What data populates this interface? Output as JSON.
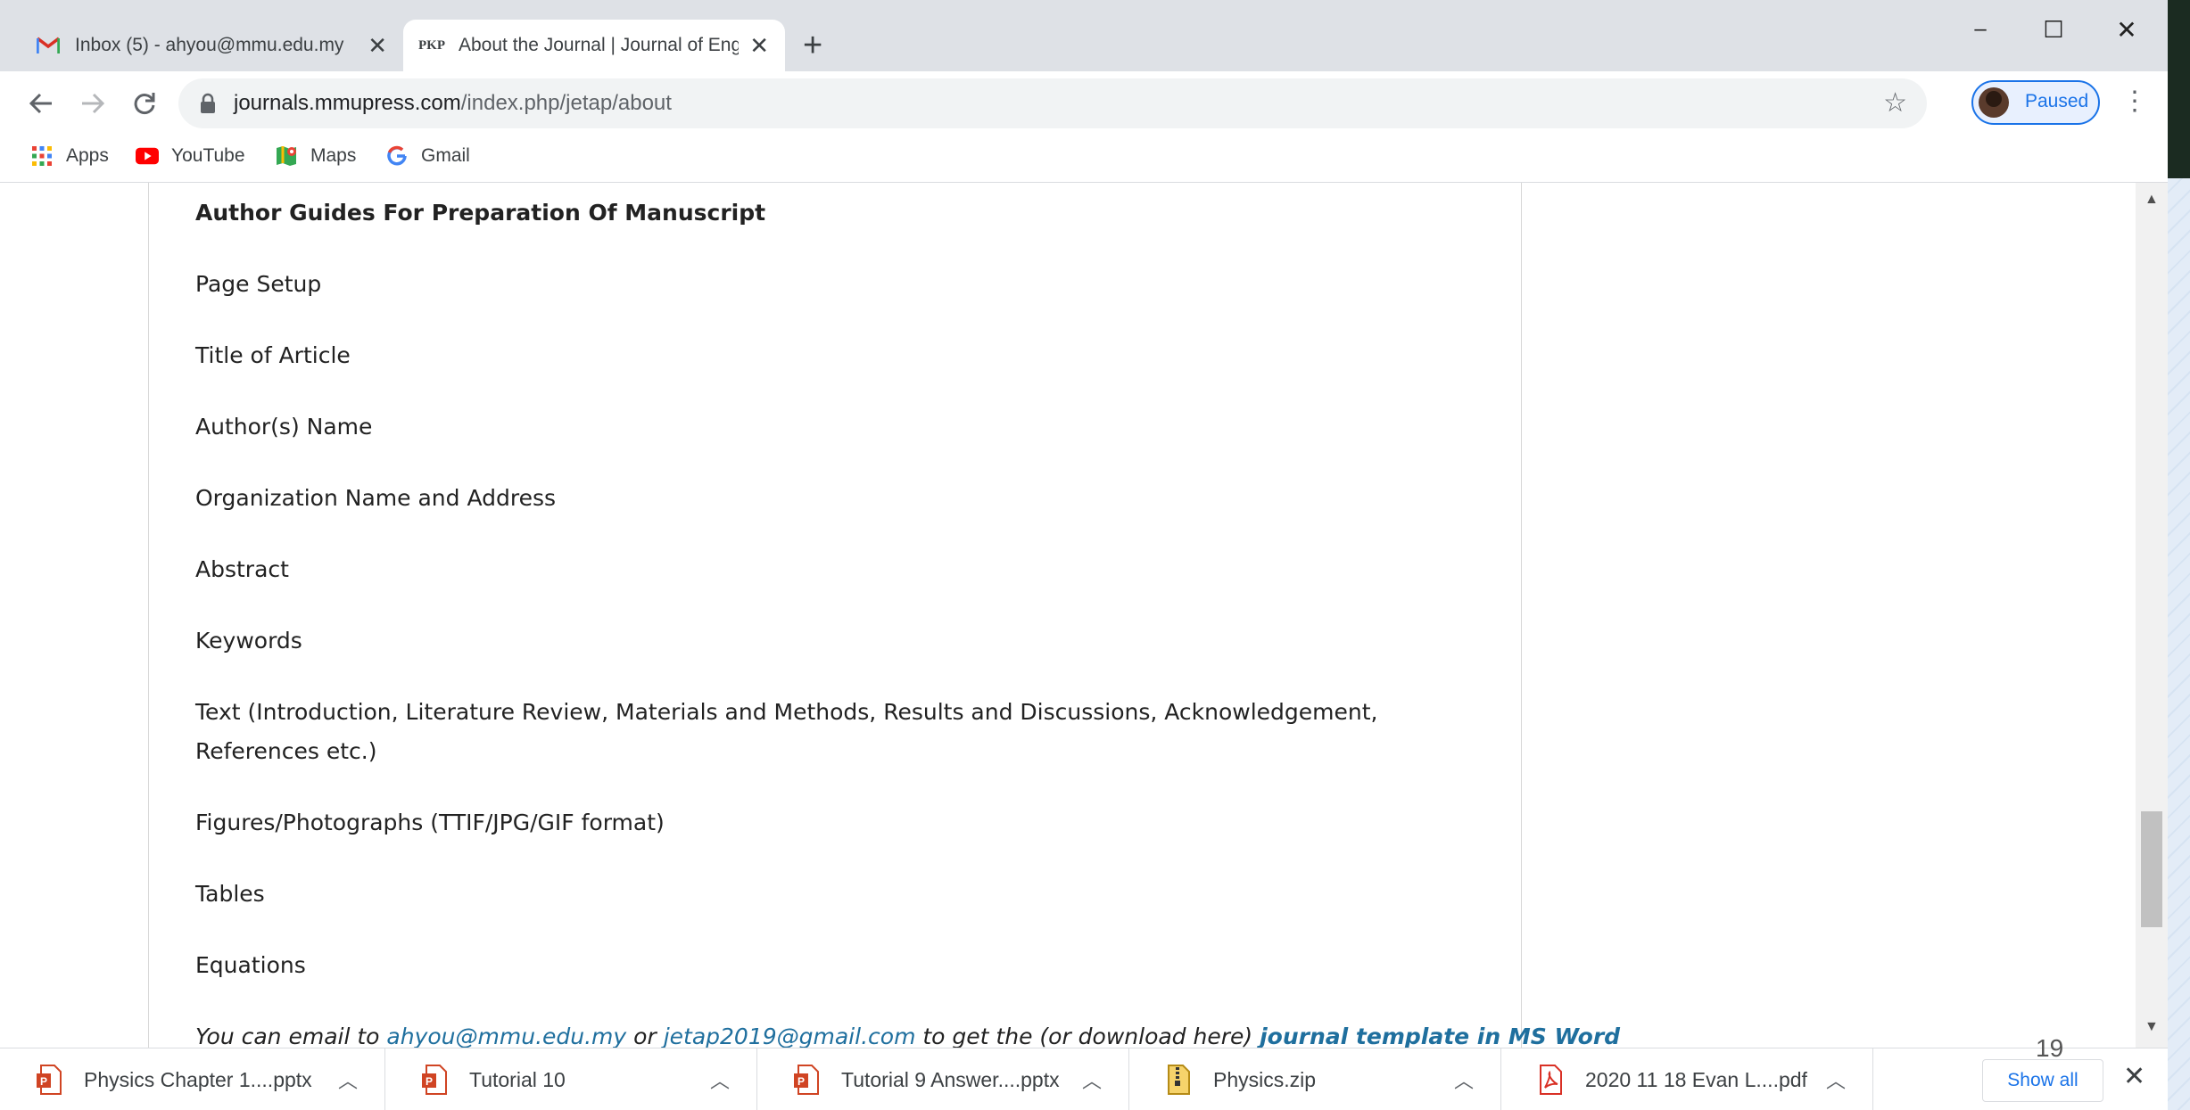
{
  "tabs": [
    {
      "title": "Inbox (5) - ahyou@mmu.edu.my",
      "favicon": "gmail-icon",
      "active": false
    },
    {
      "title": "About the Journal | Journal of Eng",
      "favicon": "PKP",
      "active": true
    }
  ],
  "window_controls": {
    "minimize": "–",
    "maximize": "☐",
    "close": "✕"
  },
  "address_bar": {
    "host": "journals.mmupress.com",
    "path": "/index.php/jetap/about"
  },
  "profile": {
    "label": "Paused"
  },
  "bookmarks": [
    {
      "label": "Apps",
      "icon": "apps-grid-icon"
    },
    {
      "label": "YouTube",
      "icon": "youtube-icon"
    },
    {
      "label": "Maps",
      "icon": "maps-icon"
    },
    {
      "label": "Gmail",
      "icon": "google-icon"
    }
  ],
  "page": {
    "heading": "Author Guides For Preparation Of Manuscript",
    "items": [
      "Page Setup",
      "Title of Article",
      "Author(s) Name",
      "Organization Name and Address",
      "Abstract",
      "Keywords",
      "Text (Introduction, Literature Review, Materials and Methods, Results and Discussions, Acknowledgement, References etc.)",
      "Figures/Photographs (TTIF/JPG/GIF format)",
      "Tables",
      "Equations"
    ],
    "note": {
      "prefix": "You can email to",
      "email1": "ahyou@mmu.edu.my",
      "or": "or",
      "email2": "jetap2019@gmail.com",
      "middle": "to get the (or download here)",
      "template_link": "journal template in MS Word"
    }
  },
  "downloads": [
    {
      "name": "Physics Chapter 1....pptx",
      "icon": "powerpoint-icon"
    },
    {
      "name": "Tutorial 10",
      "icon": "powerpoint-icon"
    },
    {
      "name": "Tutorial 9 Answer....pptx",
      "icon": "powerpoint-icon"
    },
    {
      "name": "Physics.zip",
      "icon": "zip-icon"
    },
    {
      "name": "2020 11 18 Evan L....pdf",
      "icon": "pdf-icon"
    }
  ],
  "downloads_show_all": "Show all",
  "slide_number": "19",
  "colors": {
    "accent": "#1a73e8",
    "link": "#1f6f9e",
    "tabstrip": "#dee1e6"
  }
}
